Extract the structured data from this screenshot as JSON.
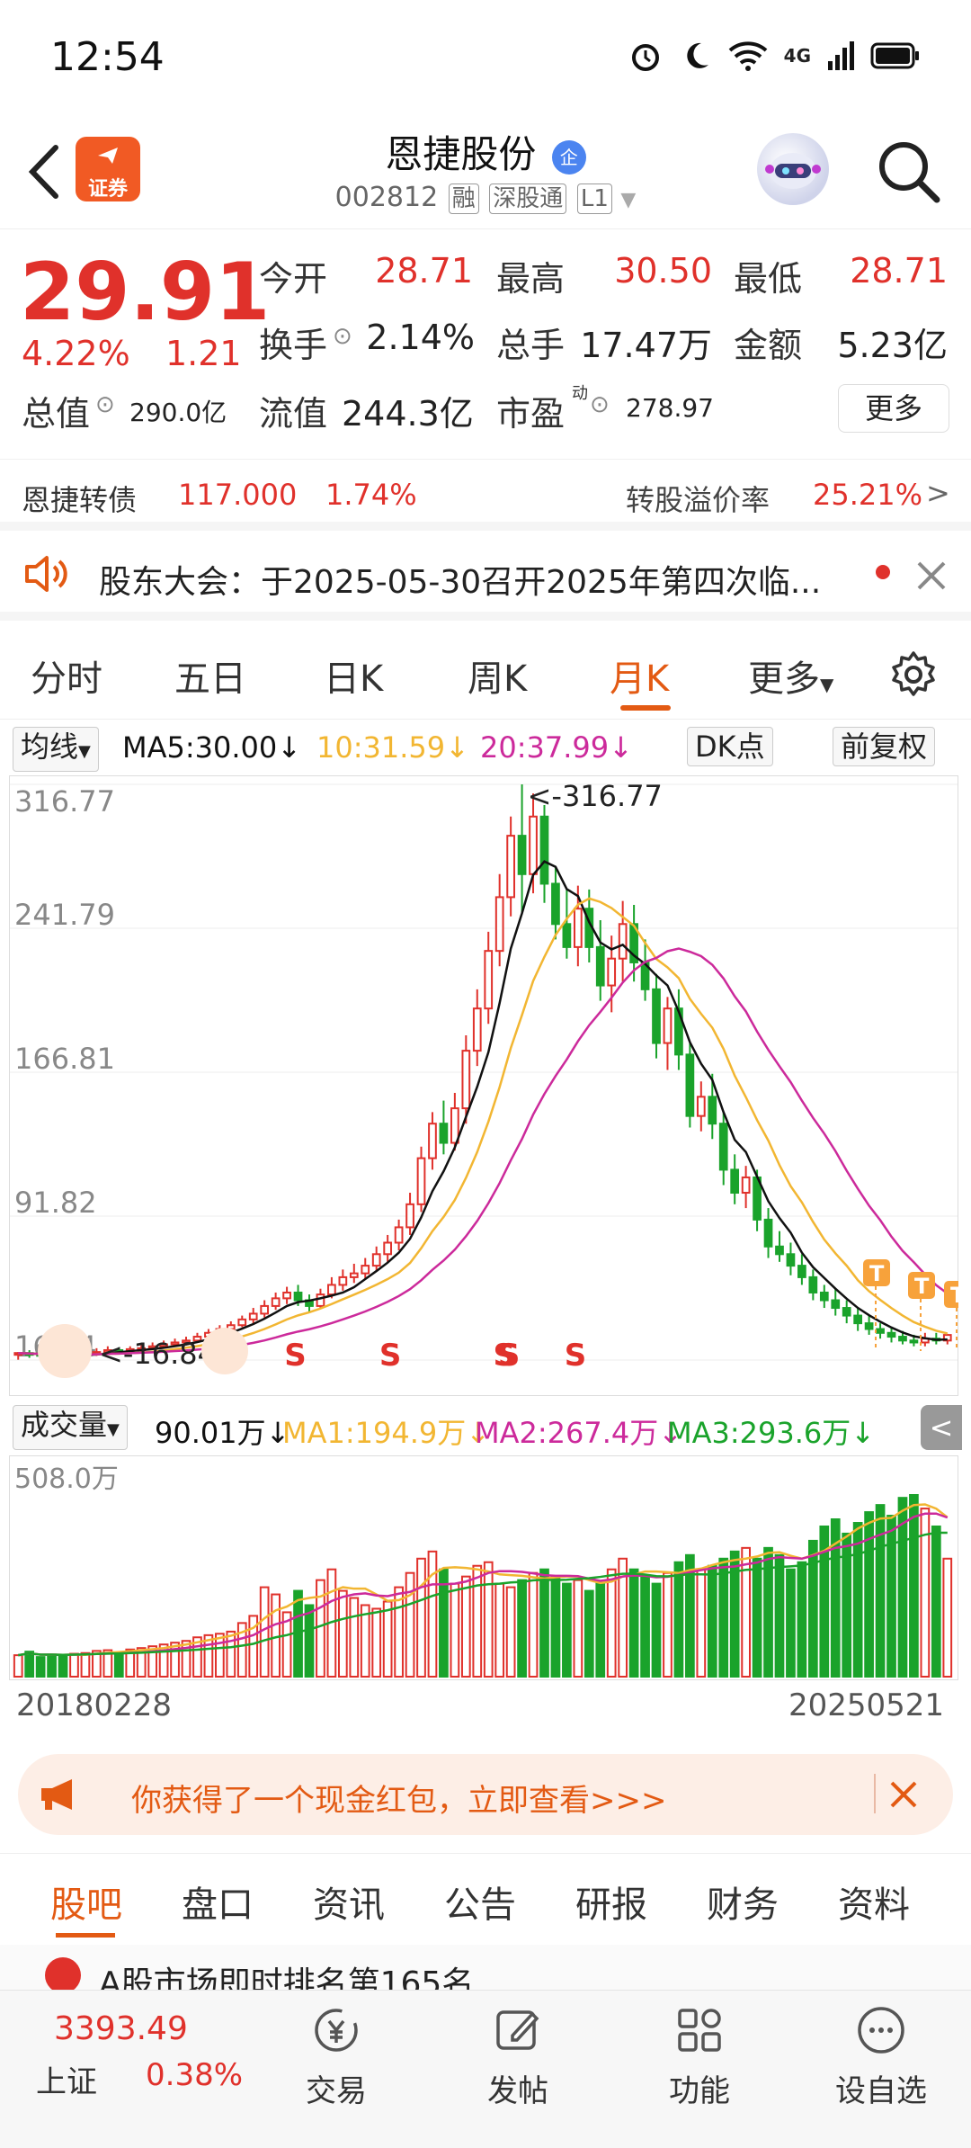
{
  "status_bar": {
    "time": "12:54",
    "network": "4G"
  },
  "header": {
    "broker_label": "证券",
    "title": "恩捷股份",
    "title_badge": "企",
    "code": "002812",
    "tags": [
      "融",
      "深股通",
      "L1"
    ]
  },
  "quote": {
    "price": "29.91",
    "change_pct": "4.22%",
    "change": "1.21",
    "fields": {
      "open_label": "今开",
      "open": "28.71",
      "high_label": "最高",
      "high": "30.50",
      "low_label": "最低",
      "low": "28.71",
      "turnover_label": "换手",
      "turnover": "2.14%",
      "volume_label": "总手",
      "volume": "17.47万",
      "amount_label": "金额",
      "amount": "5.23亿",
      "mktcap_label": "总值",
      "mktcap": "290.0亿",
      "float_label": "流值",
      "float_cap": "244.3亿",
      "pe_label": "市盈",
      "pe_sup": "动",
      "pe": "278.97"
    },
    "more_button": "更多"
  },
  "bond": {
    "name": "恩捷转债",
    "price": "117.000",
    "pct": "1.74%",
    "premium_label": "转股溢价率",
    "premium": "25.21%"
  },
  "notice": {
    "text": "股东大会：于2025-05-30召开2025年第四次临..."
  },
  "kline_tabs": [
    "分时",
    "五日",
    "日K",
    "周K",
    "月K",
    "更多"
  ],
  "active_tab": "月K",
  "ma_legend": {
    "selector": "均线",
    "ma5": "MA5:30.00↓",
    "ma10": "10:31.59↓",
    "ma20": "20:37.99↓",
    "dk": "DK点",
    "adjust": "前复权"
  },
  "colors": {
    "up": "#e0312b",
    "down": "#1aa32b",
    "ma5": "#111111",
    "ma10": "#f2b632",
    "ma20": "#cc2a9b",
    "accent": "#e35a13"
  },
  "chart_data": [
    {
      "type": "candlestick",
      "title": "",
      "period": "monthly",
      "y_ticks": [
        "316.77",
        "241.79",
        "166.81",
        "91.82",
        "16.84"
      ],
      "ylim": [
        16.84,
        316.77
      ],
      "max_label": "<-316.77",
      "min_label": "<-16.84",
      "markers": [
        "S",
        "S",
        "S",
        "S",
        "S",
        "S",
        "T",
        "T",
        "T"
      ],
      "candles": [
        [
          20,
          20.5,
          17,
          21
        ],
        [
          20.5,
          20,
          18,
          22
        ],
        [
          20,
          19.5,
          17.5,
          21
        ],
        [
          19.5,
          19,
          17,
          20.5
        ],
        [
          19,
          18.5,
          16.8,
          20
        ],
        [
          18.5,
          19.5,
          17.5,
          21
        ],
        [
          19.5,
          20.5,
          18.5,
          22
        ],
        [
          20.5,
          21,
          19,
          23
        ],
        [
          21,
          22,
          20,
          24
        ],
        [
          22,
          21.5,
          20,
          23.5
        ],
        [
          21.5,
          22.5,
          20.5,
          24
        ],
        [
          22.5,
          23,
          21,
          25
        ],
        [
          23,
          24,
          22,
          26
        ],
        [
          24,
          25,
          23,
          27
        ],
        [
          25,
          26,
          24,
          28
        ],
        [
          26,
          27,
          24.5,
          29
        ],
        [
          27,
          29,
          26,
          31
        ],
        [
          29,
          31,
          28,
          33
        ],
        [
          31,
          33,
          30,
          35
        ],
        [
          33,
          35,
          31,
          37
        ],
        [
          35,
          38,
          34,
          40
        ],
        [
          38,
          41,
          36,
          44
        ],
        [
          41,
          45,
          39,
          48
        ],
        [
          45,
          49,
          43,
          52
        ],
        [
          49,
          52,
          46,
          55
        ],
        [
          52,
          48,
          45,
          56
        ],
        [
          48,
          45,
          42,
          51
        ],
        [
          45,
          51,
          44,
          54
        ],
        [
          51,
          56,
          49,
          60
        ],
        [
          56,
          60,
          53,
          64
        ],
        [
          60,
          62,
          57,
          67
        ],
        [
          62,
          66,
          59,
          70
        ],
        [
          66,
          72,
          63,
          76
        ],
        [
          72,
          78,
          68,
          82
        ],
        [
          78,
          86,
          74,
          90
        ],
        [
          86,
          98,
          82,
          104
        ],
        [
          98,
          122,
          94,
          128
        ],
        [
          122,
          140,
          116,
          146
        ],
        [
          140,
          130,
          124,
          152
        ],
        [
          130,
          148,
          126,
          156
        ],
        [
          148,
          178,
          140,
          186
        ],
        [
          178,
          200,
          170,
          210
        ],
        [
          200,
          230,
          192,
          240
        ],
        [
          230,
          258,
          222,
          270
        ],
        [
          258,
          290,
          248,
          300
        ],
        [
          290,
          270,
          250,
          316.77
        ],
        [
          270,
          300,
          260,
          312
        ],
        [
          300,
          265,
          255,
          306
        ],
        [
          265,
          244,
          236,
          274
        ],
        [
          244,
          232,
          226,
          262
        ],
        [
          232,
          252,
          222,
          264
        ],
        [
          252,
          232,
          224,
          262
        ],
        [
          232,
          212,
          204,
          246
        ],
        [
          212,
          226,
          198,
          238
        ],
        [
          226,
          244,
          214,
          256
        ],
        [
          244,
          224,
          214,
          254
        ],
        [
          224,
          210,
          204,
          236
        ],
        [
          210,
          182,
          174,
          218
        ],
        [
          182,
          200,
          168,
          206
        ],
        [
          200,
          176,
          168,
          210
        ],
        [
          176,
          144,
          138,
          182
        ],
        [
          144,
          154,
          136,
          162
        ],
        [
          154,
          140,
          132,
          166
        ],
        [
          140,
          116,
          108,
          146
        ],
        [
          116,
          104,
          98,
          124
        ],
        [
          104,
          112,
          96,
          118
        ],
        [
          112,
          90,
          84,
          116
        ],
        [
          90,
          76,
          70,
          96
        ],
        [
          76,
          72,
          68,
          84
        ],
        [
          72,
          66,
          61,
          78
        ],
        [
          66,
          60,
          56,
          72
        ],
        [
          60,
          52,
          48,
          64
        ],
        [
          52,
          48,
          44,
          56
        ],
        [
          48,
          44,
          40,
          54
        ],
        [
          44,
          40,
          36,
          48
        ],
        [
          40,
          36,
          32,
          44
        ],
        [
          36,
          33,
          30,
          40
        ],
        [
          33,
          31,
          28,
          36
        ],
        [
          31,
          29,
          26,
          34
        ],
        [
          29,
          27,
          25,
          32
        ],
        [
          27,
          26,
          24,
          30
        ],
        [
          26,
          28,
          24,
          31
        ],
        [
          28,
          27,
          25,
          31
        ],
        [
          27,
          29.91,
          25,
          30.5
        ]
      ],
      "ma_series": [
        {
          "name": "MA5",
          "value": "30.00"
        },
        {
          "name": "MA10",
          "value": "31.59"
        },
        {
          "name": "MA20",
          "value": "37.99"
        }
      ]
    },
    {
      "type": "bar",
      "title": "成交量",
      "y_tick": "508.0万",
      "ylim": [
        0,
        508
      ],
      "x_start": "20180228",
      "x_end": "20250521",
      "legend": {
        "vol": "90.01万↓",
        "ma1": "MA1:194.9万↓",
        "ma2": "MA2:267.4万↓",
        "ma3": "MA3:293.6万↓"
      },
      "values": [
        60,
        70,
        55,
        62,
        58,
        64,
        66,
        72,
        74,
        68,
        76,
        80,
        85,
        90,
        95,
        100,
        110,
        116,
        120,
        126,
        150,
        170,
        250,
        230,
        180,
        240,
        200,
        270,
        300,
        240,
        220,
        200,
        190,
        210,
        250,
        290,
        330,
        350,
        300,
        260,
        280,
        310,
        320,
        260,
        250,
        270,
        290,
        300,
        280,
        260,
        270,
        240,
        260,
        300,
        330,
        300,
        280,
        260,
        290,
        320,
        340,
        300,
        310,
        330,
        350,
        360,
        330,
        360,
        340,
        300,
        320,
        380,
        420,
        440,
        400,
        430,
        460,
        480,
        450,
        500,
        508,
        470,
        420,
        330
      ]
    }
  ],
  "vol_selector": "成交量",
  "banner": {
    "text": "你获得了一个现金红包，立即查看>>>"
  },
  "info_tabs": [
    "股吧",
    "盘口",
    "资讯",
    "公告",
    "研报",
    "财务",
    "资料"
  ],
  "peek_text": "A股市场即时排名第165名",
  "bottom_nav": {
    "index_value": "3393.49",
    "index_name": "上证",
    "index_pct": "0.38%",
    "items": [
      "交易",
      "发帖",
      "功能",
      "设自选"
    ]
  }
}
